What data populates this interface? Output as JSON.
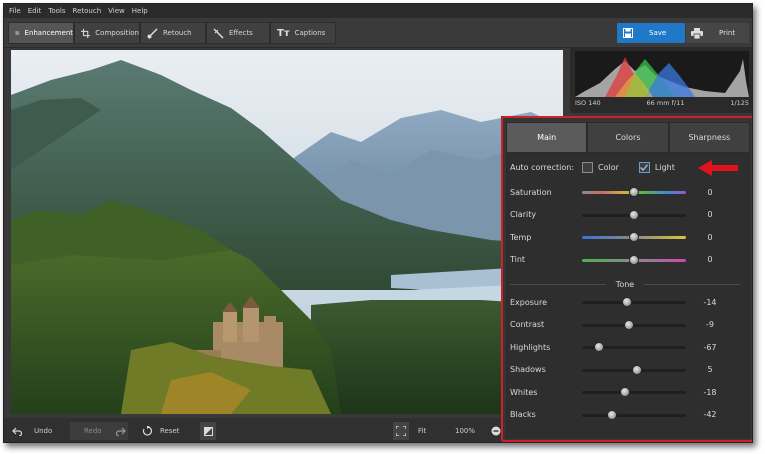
{
  "menu": [
    "File",
    "Edit",
    "Tools",
    "Retouch",
    "View",
    "Help"
  ],
  "toolbar": {
    "tabs": [
      {
        "label": "Enhancement",
        "icon": "sliders-icon"
      },
      {
        "label": "Composition",
        "icon": "crop-icon"
      },
      {
        "label": "Retouch",
        "icon": "brush-icon"
      },
      {
        "label": "Effects",
        "icon": "magic-wand-icon"
      },
      {
        "label": "Captions",
        "icon": "text-icon"
      }
    ],
    "save_label": "Save",
    "print_label": "Print"
  },
  "bottom": {
    "undo": "Undo",
    "redo": "Redo",
    "reset": "Reset",
    "fit": "Fit",
    "zoom": "100%"
  },
  "histogram": {
    "iso": "ISO 140",
    "lens": "66 mm f/11",
    "shutter": "1/125"
  },
  "panel": {
    "tabs": [
      "Main",
      "Colors",
      "Sharpness"
    ],
    "active_tab": "Main",
    "auto_correction": {
      "label": "Auto correction:",
      "color_label": "Color",
      "color_checked": false,
      "light_label": "Light",
      "light_checked": true
    },
    "basic": [
      {
        "label": "Saturation",
        "value": "0",
        "pos": 0.5,
        "track": "saturation"
      },
      {
        "label": "Clarity",
        "value": "0",
        "pos": 0.5,
        "track": "plain"
      },
      {
        "label": "Temp",
        "value": "0",
        "pos": 0.5,
        "track": "temp"
      },
      {
        "label": "Tint",
        "value": "0",
        "pos": 0.5,
        "track": "tint"
      }
    ],
    "tone_label": "Tone",
    "tone": [
      {
        "label": "Exposure",
        "value": "-14",
        "pos": 0.43
      },
      {
        "label": "Contrast",
        "value": "-9",
        "pos": 0.455
      },
      {
        "label": "Highlights",
        "value": "-67",
        "pos": 0.165
      },
      {
        "label": "Shadows",
        "value": "5",
        "pos": 0.525
      },
      {
        "label": "Whites",
        "value": "-18",
        "pos": 0.41
      },
      {
        "label": "Blacks",
        "value": "-42",
        "pos": 0.29
      }
    ]
  },
  "colors": {
    "accent": "#1f78c8",
    "highlight_border": "#d1202a"
  }
}
